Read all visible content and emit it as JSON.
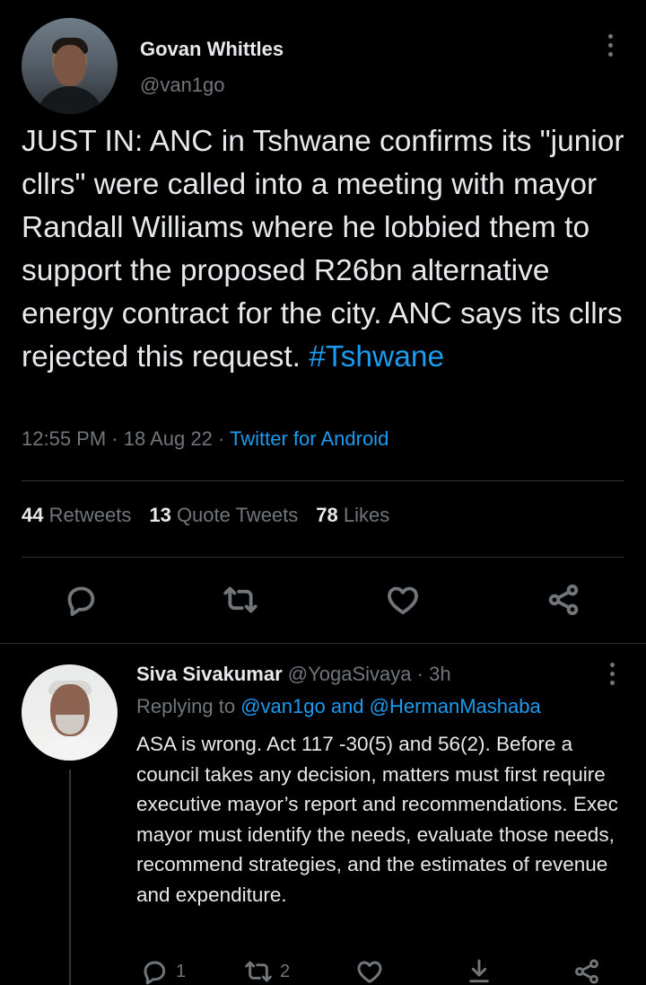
{
  "tweet": {
    "author_name": "Govan Whittles",
    "author_handle": "@van1go",
    "text": "JUST IN: ANC in Tshwane confirms its \"junior cllrs\" were called into a meeting with mayor Randall Williams where he lobbied them to support the proposed R26bn alternative energy contract for the city. ANC says its cllrs rejected this request. ",
    "hashtag": "#Tshwane",
    "time": "12:55 PM",
    "date": "18 Aug 22",
    "separator": " · ",
    "source": "Twitter for Android",
    "stats": {
      "retweets_count": "44",
      "retweets_label": "Retweets",
      "quotes_count": "13",
      "quotes_label": "Quote Tweets",
      "likes_count": "78",
      "likes_label": "Likes"
    },
    "actions": [
      "reply-icon",
      "retweet-icon",
      "like-icon",
      "share-icon"
    ]
  },
  "reply": {
    "author_name": "Siva Sivakumar",
    "author_handle": "@YogaSivaya",
    "time_ago": "3h",
    "separator": " · ",
    "replying_prefix": "Replying to ",
    "replying_to_1": "@van1go",
    "replying_and": " and ",
    "replying_to_2": "@HermanMashaba",
    "text": "ASA is wrong. Act 117 -30(5) and 56(2). Before a council takes any decision, matters must first require executive mayor’s report and recommendations. Exec mayor must identify the needs, evaluate those needs, recommend strategies, and the estimates of revenue and expenditure.",
    "reply_count": "1",
    "retweet_count": "2",
    "actions": [
      "reply-icon",
      "retweet-icon",
      "like-icon",
      "bookmark-icon",
      "share-icon"
    ]
  },
  "colors": {
    "background": "#000000",
    "text": "#e7e9ea",
    "muted": "#71767b",
    "link": "#1d9bf0",
    "divider": "#2f3336"
  }
}
